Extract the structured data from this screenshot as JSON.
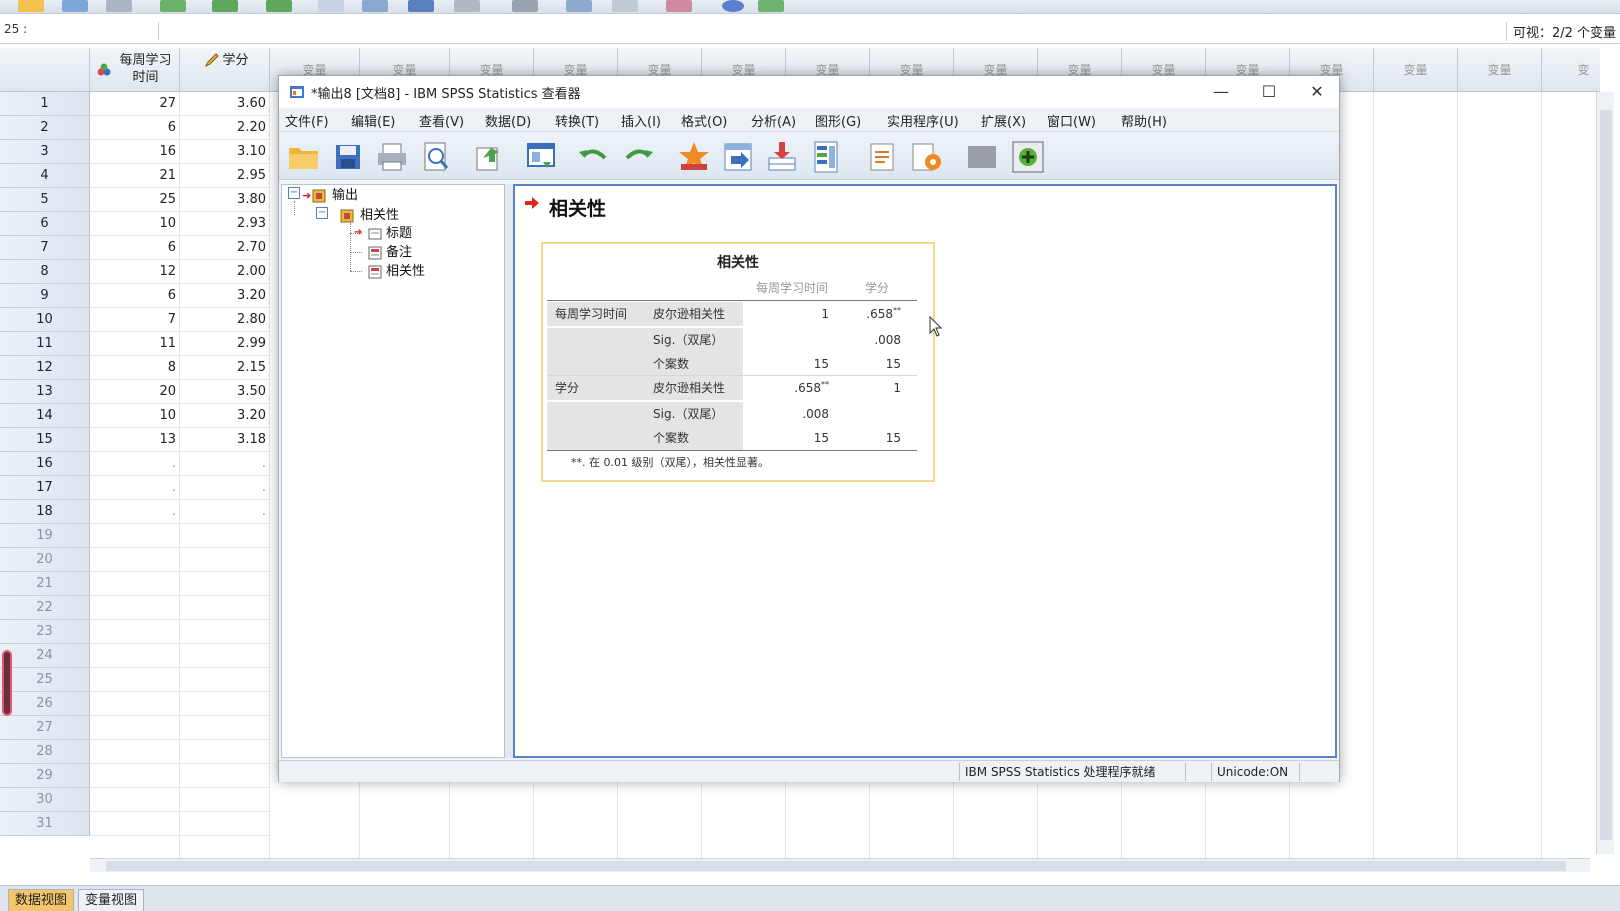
{
  "cell_reference": "25 :",
  "visible_vars": "可视：2/2 个变量",
  "grid": {
    "columns": [
      {
        "label_line1": "每周学习",
        "label_line2": "时间",
        "icon": "scale-nominal-icon"
      },
      {
        "label_line1": "学分",
        "label_line2": "",
        "icon": "pencil-scale-icon"
      },
      {
        "label_line1": "变量"
      },
      {
        "label_line1": "变量"
      },
      {
        "label_line1": "变量"
      },
      {
        "label_line1": "变量"
      },
      {
        "label_line1": "变量"
      },
      {
        "label_line1": "变量"
      },
      {
        "label_line1": "变量"
      },
      {
        "label_line1": "变量"
      },
      {
        "label_line1": "变量"
      },
      {
        "label_line1": "变量"
      },
      {
        "label_line1": "变量"
      },
      {
        "label_line1": "变量"
      },
      {
        "label_line1": "变量"
      },
      {
        "label_line1": "变量"
      },
      {
        "label_line1": "变量"
      },
      {
        "label_line1": "变"
      }
    ],
    "rows": [
      {
        "n": "1",
        "a": "27",
        "b": "3.60"
      },
      {
        "n": "2",
        "a": "6",
        "b": "2.20"
      },
      {
        "n": "3",
        "a": "16",
        "b": "3.10"
      },
      {
        "n": "4",
        "a": "21",
        "b": "2.95"
      },
      {
        "n": "5",
        "a": "25",
        "b": "3.80"
      },
      {
        "n": "6",
        "a": "10",
        "b": "2.93"
      },
      {
        "n": "7",
        "a": "6",
        "b": "2.70"
      },
      {
        "n": "8",
        "a": "12",
        "b": "2.00"
      },
      {
        "n": "9",
        "a": "6",
        "b": "3.20"
      },
      {
        "n": "10",
        "a": "7",
        "b": "2.80"
      },
      {
        "n": "11",
        "a": "11",
        "b": "2.99"
      },
      {
        "n": "12",
        "a": "8",
        "b": "2.15"
      },
      {
        "n": "13",
        "a": "20",
        "b": "3.50"
      },
      {
        "n": "14",
        "a": "10",
        "b": "3.20"
      },
      {
        "n": "15",
        "a": "13",
        "b": "3.18"
      },
      {
        "n": "16",
        "a": ".",
        "b": "."
      },
      {
        "n": "17",
        "a": ".",
        "b": "."
      },
      {
        "n": "18",
        "a": ".",
        "b": "."
      },
      {
        "n": "19",
        "a": "",
        "b": ""
      },
      {
        "n": "20",
        "a": "",
        "b": ""
      },
      {
        "n": "21",
        "a": "",
        "b": ""
      },
      {
        "n": "22",
        "a": "",
        "b": ""
      },
      {
        "n": "23",
        "a": "",
        "b": ""
      },
      {
        "n": "24",
        "a": "",
        "b": ""
      },
      {
        "n": "25",
        "a": "",
        "b": ""
      },
      {
        "n": "26",
        "a": "",
        "b": ""
      },
      {
        "n": "27",
        "a": "",
        "b": ""
      },
      {
        "n": "28",
        "a": "",
        "b": ""
      },
      {
        "n": "29",
        "a": "",
        "b": ""
      },
      {
        "n": "30",
        "a": "",
        "b": ""
      },
      {
        "n": "31",
        "a": "",
        "b": ""
      }
    ]
  },
  "bottom_tabs": {
    "data_view": "数据视图",
    "variable_view": "变量视图"
  },
  "viewer": {
    "title": "*输出8 [文档8] - IBM SPSS Statistics 查看器",
    "minimize": "—",
    "maximize": "☐",
    "close": "✕",
    "menu": [
      "文件(F)",
      "编辑(E)",
      "查看(V)",
      "数据(D)",
      "转换(T)",
      "插入(I)",
      "格式(O)",
      "分析(A)",
      "图形(G)",
      "实用程序(U)",
      "扩展(X)",
      "窗口(W)",
      "帮助(H)"
    ],
    "toolbar_icons": [
      "open-folder-icon",
      "save-icon",
      "print-icon",
      "print-preview-icon",
      "export-icon",
      "recall-dialog-icon",
      "undo-icon",
      "redo-icon",
      "goto-data-icon",
      "goto-case-icon",
      "goto-variable-icon",
      "variables-icon",
      "create-title-icon",
      "insert-output-icon",
      "hidden-icon",
      "add-item-icon"
    ],
    "tree": {
      "root": "输出",
      "group": "相关性",
      "items": [
        "标题",
        "备注",
        "相关性"
      ]
    },
    "output_heading": "相关性",
    "table": {
      "title": "相关性",
      "col_headers": [
        "每周学习时间",
        "学分"
      ],
      "rows": [
        {
          "var": "每周学习时间",
          "stat": "皮尔逊相关性",
          "v1": "1",
          "v2": ".658",
          "v2_sup": "**",
          "v1_sup": ""
        },
        {
          "var": "",
          "stat": "Sig.（双尾）",
          "v1": "",
          "v2": ".008",
          "v2_sup": "",
          "v1_sup": ""
        },
        {
          "var": "",
          "stat": "个案数",
          "v1": "15",
          "v2": "15",
          "v2_sup": "",
          "v1_sup": ""
        },
        {
          "var": "学分",
          "stat": "皮尔逊相关性",
          "v1": ".658",
          "v1_sup": "**",
          "v2": "1",
          "v2_sup": ""
        },
        {
          "var": "",
          "stat": "Sig.（双尾）",
          "v1": ".008",
          "v2": "",
          "v1_sup": "",
          "v2_sup": ""
        },
        {
          "var": "",
          "stat": "个案数",
          "v1": "15",
          "v2": "15",
          "v1_sup": "",
          "v2_sup": ""
        }
      ],
      "footnote": "**. 在 0.01 级别（双尾），相关性显著。"
    },
    "status": {
      "processor": "IBM SPSS Statistics 处理程序就绪",
      "unicode": "Unicode:ON"
    }
  },
  "colors": {
    "accent": "#5b82c4",
    "active_tab": "#f3c66b",
    "table_border": "#f4d98a"
  }
}
